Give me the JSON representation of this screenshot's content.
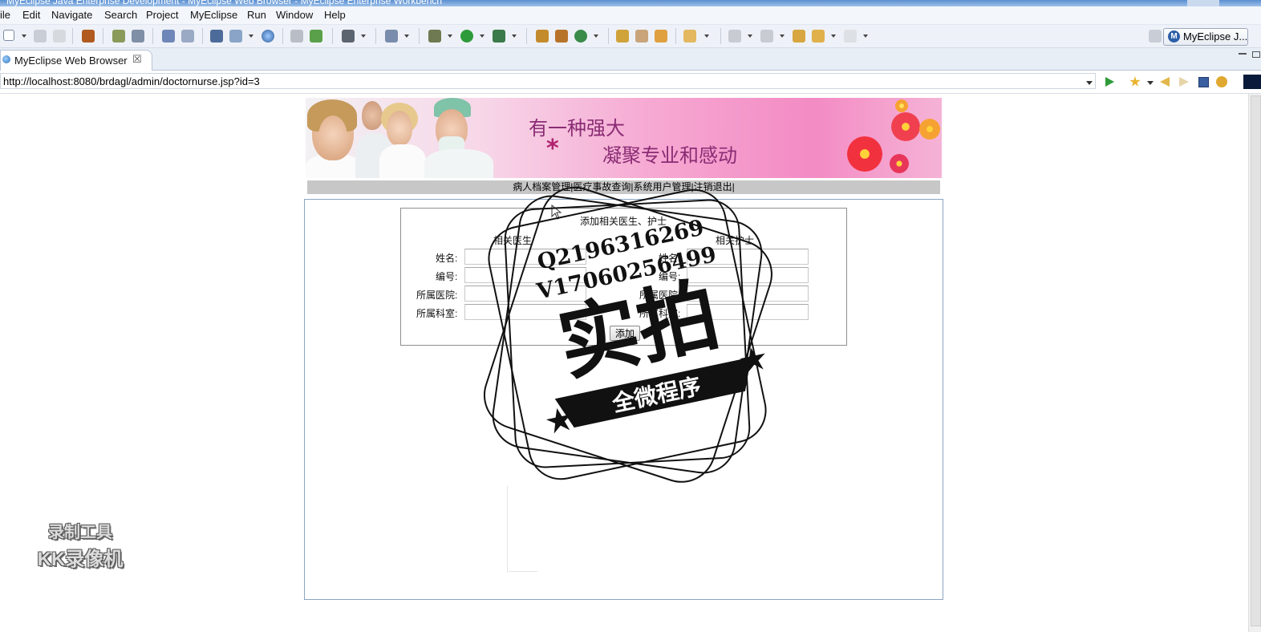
{
  "window": {
    "title": "MyEclipse Java Enterprise Development - MyEclipse Web Browser - MyEclipse Enterprise Workbench"
  },
  "menubar": {
    "items": [
      "ile",
      "Edit",
      "Navigate",
      "Search",
      "Project",
      "MyEclipse",
      "Run",
      "Window",
      "Help"
    ]
  },
  "toolbar": {
    "perspective_label": "MyEclipse J...",
    "perspective_icon_letter": "M"
  },
  "editor_tab": {
    "label": "MyEclipse Web Browser",
    "close": "☒"
  },
  "browser": {
    "url": "http://localhost:8080/brdagl/admin/doctornurse.jsp?id=3"
  },
  "banner": {
    "line1": "有一种强大",
    "line2": "凝聚专业和感动",
    "star": "*"
  },
  "nav": {
    "items": [
      "病人档案管理",
      "医疗事故查询",
      "系统用户管理",
      "注销退出"
    ],
    "separator": "|"
  },
  "form": {
    "title": "添加相关医生、护士",
    "doctor_heading": "相关医生",
    "nurse_heading": "相关护士",
    "doctor_fields": {
      "name_label": "姓名:",
      "number_label": "编号:",
      "hospital_label": "所属医院:",
      "department_label": "所属科室:"
    },
    "nurse_fields": {
      "name_label": "姓名:",
      "number_label": "编号:",
      "hospital_label": "所属医院:",
      "department_label": "所属科室:"
    },
    "add_button": "添加"
  },
  "watermark": {
    "qq": "Q2196316269",
    "vx": "V17060256499",
    "big": "实拍",
    "ribbon": "全微程序",
    "recorder_line1": "录制工具",
    "recorder_line2": "KK录像机"
  },
  "colors": {
    "banner_text": "#8a2c74",
    "nav_bg": "#c7c7c7",
    "frame_border": "#8ba4c3"
  }
}
